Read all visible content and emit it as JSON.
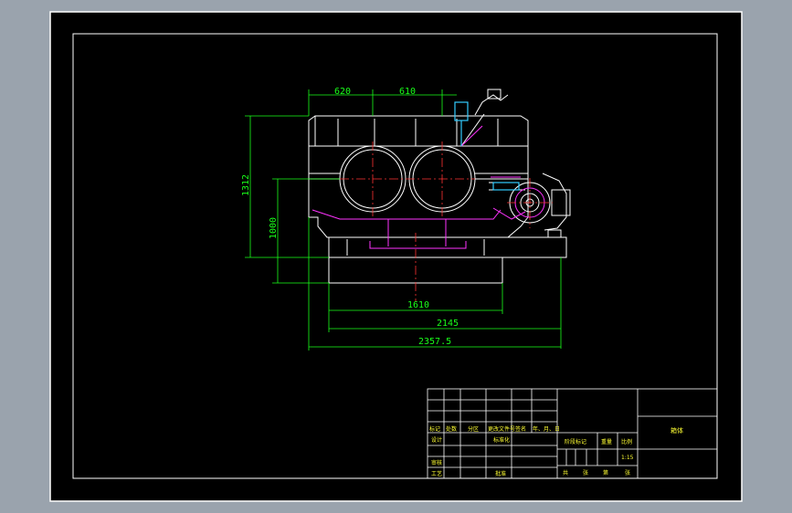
{
  "dimensions": {
    "width_620": "620",
    "width_610": "610",
    "height_1312": "1312",
    "height_1000": "1000",
    "length_1610": "1610",
    "length_2145": "2145",
    "length_2357": "2357.5"
  },
  "title_block": {
    "col_mark": "标记",
    "col_count": "处数",
    "col_zone": "分区",
    "col_doc": "更改文件号",
    "col_sign": "签名",
    "col_date": "年、月、日",
    "row_design": "设计",
    "row_standard": "标准化",
    "row_check": "审核",
    "row_process": "工艺",
    "row_approve": "批准",
    "stage_mark": "阶段标记",
    "weight": "重量",
    "scale_label": "比例",
    "scale_value": "1:15",
    "sheet_total": "共",
    "sheet_unit_1": "张",
    "sheet_of": "第",
    "sheet_unit_2": "张",
    "drawing_name": "箱体"
  },
  "colors": {
    "frame_outer": "#ffffff",
    "geometry": "#ffffff",
    "dimensions": "#19ff19",
    "hidden_parts": "#ff33ff",
    "axes": "#ff3333",
    "highlight": "#33ccff",
    "text": "#ffff33"
  }
}
